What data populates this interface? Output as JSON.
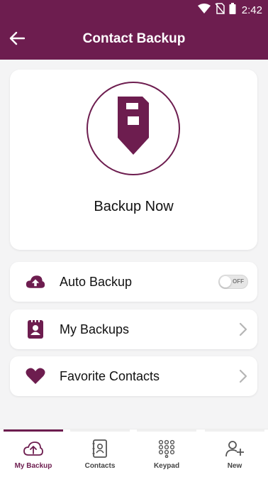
{
  "status_bar": {
    "time": "2:42",
    "icons": [
      "wifi-icon",
      "no-sim-icon",
      "battery-icon"
    ]
  },
  "app_bar": {
    "title": "Contact Backup",
    "back_icon": "arrow-left-icon"
  },
  "hero": {
    "label": "Backup Now",
    "icon": "save-download-icon"
  },
  "rows": [
    {
      "label": "Auto Backup",
      "icon": "cloud-upload-icon",
      "control": "toggle",
      "toggle_text": "OFF",
      "toggle_on": false
    },
    {
      "label": "My Backups",
      "icon": "contact-book-icon",
      "control": "chevron"
    },
    {
      "label": "Favorite Contacts",
      "icon": "heart-icon",
      "control": "chevron"
    }
  ],
  "bottom_nav": [
    {
      "label": "My Backup",
      "icon": "cloud-upload-icon",
      "active": true
    },
    {
      "label": "Contacts",
      "icon": "contacts-icon",
      "active": false
    },
    {
      "label": "Keypad",
      "icon": "keypad-icon",
      "active": false
    },
    {
      "label": "New",
      "icon": "add-person-icon",
      "active": false
    }
  ],
  "colors": {
    "primary": "#6d1d4f",
    "background": "#f4f4f5",
    "card": "#ffffff"
  }
}
